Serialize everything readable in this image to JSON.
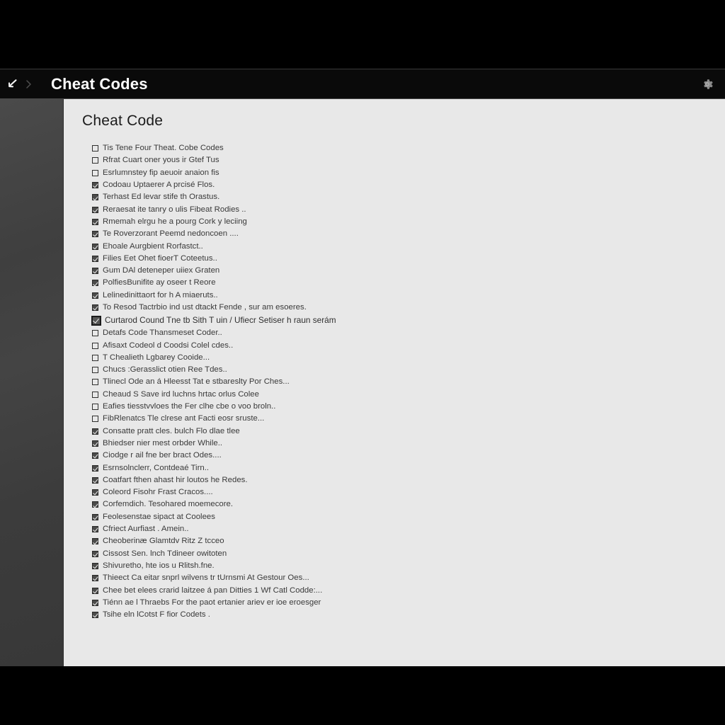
{
  "window": {
    "letterbox_color": "#000000",
    "titlebar": {
      "background": "#0a0a0a",
      "back_icon": "back-arrow",
      "separator_icon": "chevron-right",
      "title": "Cheat Codes",
      "settings_icon": "gear"
    }
  },
  "sidebar": {
    "background": "#414141",
    "items": []
  },
  "content": {
    "background": "#e8e8e8",
    "heading": "Cheat Code",
    "checklist": [
      {
        "checked": false,
        "focused": false,
        "label": "Tis Tene Four Theat. Cobe Codes"
      },
      {
        "checked": false,
        "focused": false,
        "label": "Rfrat Cuart oner yous ir Gtef Tus"
      },
      {
        "checked": false,
        "focused": false,
        "label": "Esrlumnstey fip aeuoir anaion fis"
      },
      {
        "checked": true,
        "focused": false,
        "label": "Codoau Uptaerer A prcisé Flos."
      },
      {
        "checked": true,
        "focused": false,
        "label": "Terhast Ed levar stife th Orastus."
      },
      {
        "checked": true,
        "focused": false,
        "label": "Reraesat ite tanry o ulis Fibeat Rodies .."
      },
      {
        "checked": true,
        "focused": false,
        "label": "Rmemah elrgu he a pourg Cork y leciing"
      },
      {
        "checked": true,
        "focused": false,
        "label": "Te Roverzorant Peemd nedoncoen ...."
      },
      {
        "checked": true,
        "focused": false,
        "label": "Ehoale Aurgbient Rorfastct.."
      },
      {
        "checked": true,
        "focused": false,
        "label": "Filies Eet Ohet fioerT Coteetus.."
      },
      {
        "checked": true,
        "focused": false,
        "label": "Gum DAl deteneper uiiex Graten"
      },
      {
        "checked": true,
        "focused": false,
        "label": "PolfiesBunifite ay oseer t Reore"
      },
      {
        "checked": true,
        "focused": false,
        "label": "Lelinedinittaort for h A miaeruts.."
      },
      {
        "checked": true,
        "focused": false,
        "label": "To Resod Tactrbio ind ust dtackt Fende , sur am esoeres."
      },
      {
        "checked": true,
        "focused": true,
        "label": "Curtarod Cound Tne tb Sith T uin / Ufiecr Setiser h raun serám"
      },
      {
        "checked": false,
        "focused": false,
        "label": "Detafs Code Thansmeset Coder.."
      },
      {
        "checked": false,
        "focused": false,
        "label": "Afisaxt Codeol d Coodsi Colel cdes.."
      },
      {
        "checked": false,
        "focused": false,
        "label": "T Chealieth Lgbarey Cooide..."
      },
      {
        "checked": false,
        "focused": false,
        "label": "Chucs :Gerasslict otien Ree Tdes.."
      },
      {
        "checked": false,
        "focused": false,
        "label": "Tlinecl Ode an á Hleesst Tat e stbareslty Por Ches..."
      },
      {
        "checked": false,
        "focused": false,
        "label": "Cheaud S Save ird luchns hrtac orlus Colee"
      },
      {
        "checked": false,
        "focused": false,
        "label": "Eafies tiesstvvloes the Fer clhe cbe o voo broln.."
      },
      {
        "checked": false,
        "focused": false,
        "label": "FibRlenatcs Tle clrese ant Facti eosr sruste..."
      },
      {
        "checked": true,
        "focused": false,
        "label": "Consatte pratt cles. bulch Flo dlae tlee"
      },
      {
        "checked": true,
        "focused": false,
        "label": "Bhiedser nier mest orbder While.."
      },
      {
        "checked": true,
        "focused": false,
        "label": "Ciodge r ail fne ber bract Odes...."
      },
      {
        "checked": true,
        "focused": false,
        "label": "Esrnsolnclerr, Contdeaé Tirn.."
      },
      {
        "checked": true,
        "focused": false,
        "label": "Coatfart fthen ahast hir loutos he Redes."
      },
      {
        "checked": true,
        "focused": false,
        "label": "Coleord Fisohr Frast Cracos...."
      },
      {
        "checked": true,
        "focused": false,
        "label": "Corfemdich. Tesohared moemecore."
      },
      {
        "checked": true,
        "focused": false,
        "label": "Feolesenstae sipact at Coolees"
      },
      {
        "checked": true,
        "focused": false,
        "label": "Cfriect Aurfiast . Amein.."
      },
      {
        "checked": true,
        "focused": false,
        "label": "Cheoberinæ Glamtdv Ritz Z tcceo"
      },
      {
        "checked": true,
        "focused": false,
        "label": "Cissost Sen. lnch Tdineer owitoten"
      },
      {
        "checked": true,
        "focused": false,
        "label": "Shivuretho, hte ios u Rlitsh.fne."
      },
      {
        "checked": true,
        "focused": false,
        "label": "Thieect Ca eitar snprl wilvens tr tUrnsmi At Gestour Oes..."
      },
      {
        "checked": true,
        "focused": false,
        "label": "Chee bet elees crarid laitzee á pan Ditties 1 Wf Catl Codde:..."
      },
      {
        "checked": true,
        "focused": false,
        "label": "Tiénn ae l Thraebs For the paot ertanier ariev er ioe eroesger"
      },
      {
        "checked": true,
        "focused": false,
        "label": "Tsihe eln lCotst F fior Codets ."
      }
    ]
  }
}
